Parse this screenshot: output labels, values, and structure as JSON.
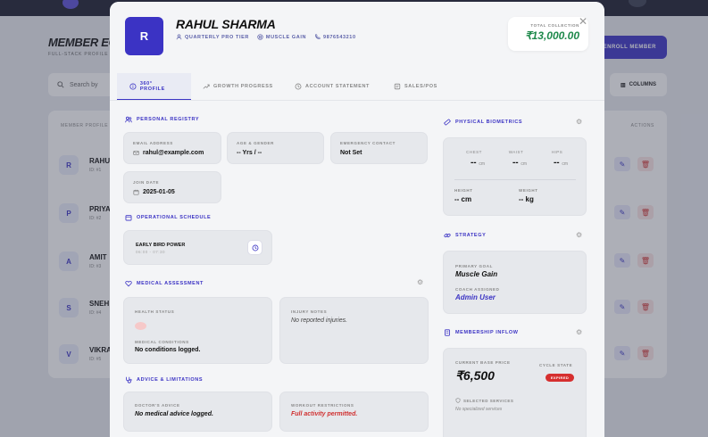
{
  "background": {
    "title": "MEMBER EC",
    "subtitle": "FULL-STACK PROFILE",
    "enroll_label": "ENROLL MEMBER",
    "search_placeholder": "Search by",
    "columns_label": "COLUMNS",
    "table_header_member": "MEMBER PROFILE",
    "table_header_actions": "ACTIONS",
    "rows": [
      {
        "initial": "R",
        "name": "RAHU",
        "id": "ID: #1"
      },
      {
        "initial": "P",
        "name": "PRIYA",
        "id": "ID: #2"
      },
      {
        "initial": "A",
        "name": "AMIT",
        "id": "ID: #3"
      },
      {
        "initial": "S",
        "name": "SNEH",
        "id": "ID: #4"
      },
      {
        "initial": "V",
        "name": "VIKRA",
        "id": "ID: #5"
      }
    ]
  },
  "member": {
    "initial": "R",
    "name": "RAHUL SHARMA",
    "tier": "QUARTERLY PRO TIER",
    "goal_tag": "MUSCLE GAIN",
    "phone": "9876543210",
    "collection_label": "TOTAL COLLECTION",
    "collection_value": "₹13,000.00"
  },
  "tabs": [
    {
      "label": "360° PROFILE"
    },
    {
      "label": "GROWTH PROGRESS"
    },
    {
      "label": "ACCOUNT STATEMENT"
    },
    {
      "label": "SALES/POS"
    }
  ],
  "registry": {
    "title": "PERSONAL REGISTRY",
    "email_label": "EMAIL ADDRESS",
    "email_value": "rahul@example.com",
    "age_label": "AGE & GENDER",
    "age_value": "-- Yrs / --",
    "emergency_label": "EMERGENCY CONTACT",
    "emergency_value": "Not Set",
    "join_label": "JOIN DATE",
    "join_value": "2025-01-05"
  },
  "schedule": {
    "title": "OPERATIONAL SCHEDULE",
    "name": "EARLY BIRD POWER",
    "time": "06:00 - 07:30"
  },
  "medical": {
    "title": "MEDICAL ASSESSMENT",
    "health_label": "HEALTH STATUS",
    "conditions_label": "MEDICAL CONDITIONS",
    "conditions_value": "No conditions logged.",
    "injury_label": "INJURY NOTES",
    "injury_value": "No reported injuries."
  },
  "advice": {
    "title": "ADVICE & LIMITATIONS",
    "doctor_label": "DOCTOR'S ADVICE",
    "doctor_value": "No medical advice logged.",
    "workout_label": "WORKOUT RESTRICTIONS",
    "workout_value": "Full activity permitted."
  },
  "biometrics": {
    "title": "PHYSICAL BIOMETRICS",
    "chest_label": "CHEST",
    "chest_value": "--",
    "waist_label": "WAIST",
    "waist_value": "--",
    "hips_label": "HIPS",
    "hips_value": "--",
    "unit_cm": "cm",
    "height_label": "HEIGHT",
    "height_value": "-- cm",
    "weight_label": "WEIGHT",
    "weight_value": "-- kg"
  },
  "strategy": {
    "title": "STRATEGY",
    "goal_label": "PRIMARY GOAL",
    "goal_value": "Muscle Gain",
    "coach_label": "COACH ASSIGNED",
    "coach_value": "Admin User"
  },
  "membership": {
    "title": "MEMBERSHIP INFLOW",
    "base_label": "CURRENT BASE PRICE",
    "base_value": "₹6,500",
    "cycle_label": "CYCLE STATE",
    "cycle_value": "EXPIRED",
    "services_label": "SELECTED SERVICES",
    "services_value": "No specialized services"
  }
}
